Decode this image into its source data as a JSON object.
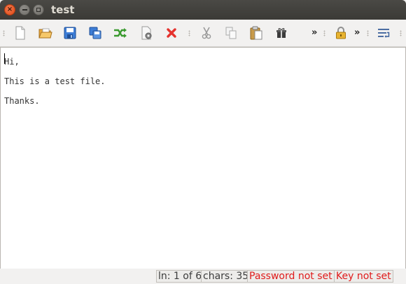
{
  "window": {
    "title": "test",
    "close_glyph": "×"
  },
  "toolbar": {
    "buttons": [
      {
        "name": "new-file-icon"
      },
      {
        "name": "open-folder-icon"
      },
      {
        "name": "save-icon"
      },
      {
        "name": "save-as-icon"
      },
      {
        "name": "shuffle-icon"
      },
      {
        "name": "preferences-icon"
      },
      {
        "name": "delete-icon"
      },
      {
        "name": "cut-icon"
      },
      {
        "name": "copy-icon"
      },
      {
        "name": "paste-icon"
      },
      {
        "name": "generate-icon"
      },
      {
        "name": "lock-icon"
      },
      {
        "name": "wrap-icon"
      }
    ],
    "overflow_glyph": "»"
  },
  "editor": {
    "content": "Hi,\nThis is a test file.\nThanks."
  },
  "statusbar": {
    "line": "ln: 1 of 6",
    "chars": "chars: 35",
    "password": "Password not set",
    "key": "Key not set"
  },
  "colors": {
    "warning": "#e01b1b",
    "close_button": "#dd4814",
    "titlebar": "#3b3a36"
  }
}
